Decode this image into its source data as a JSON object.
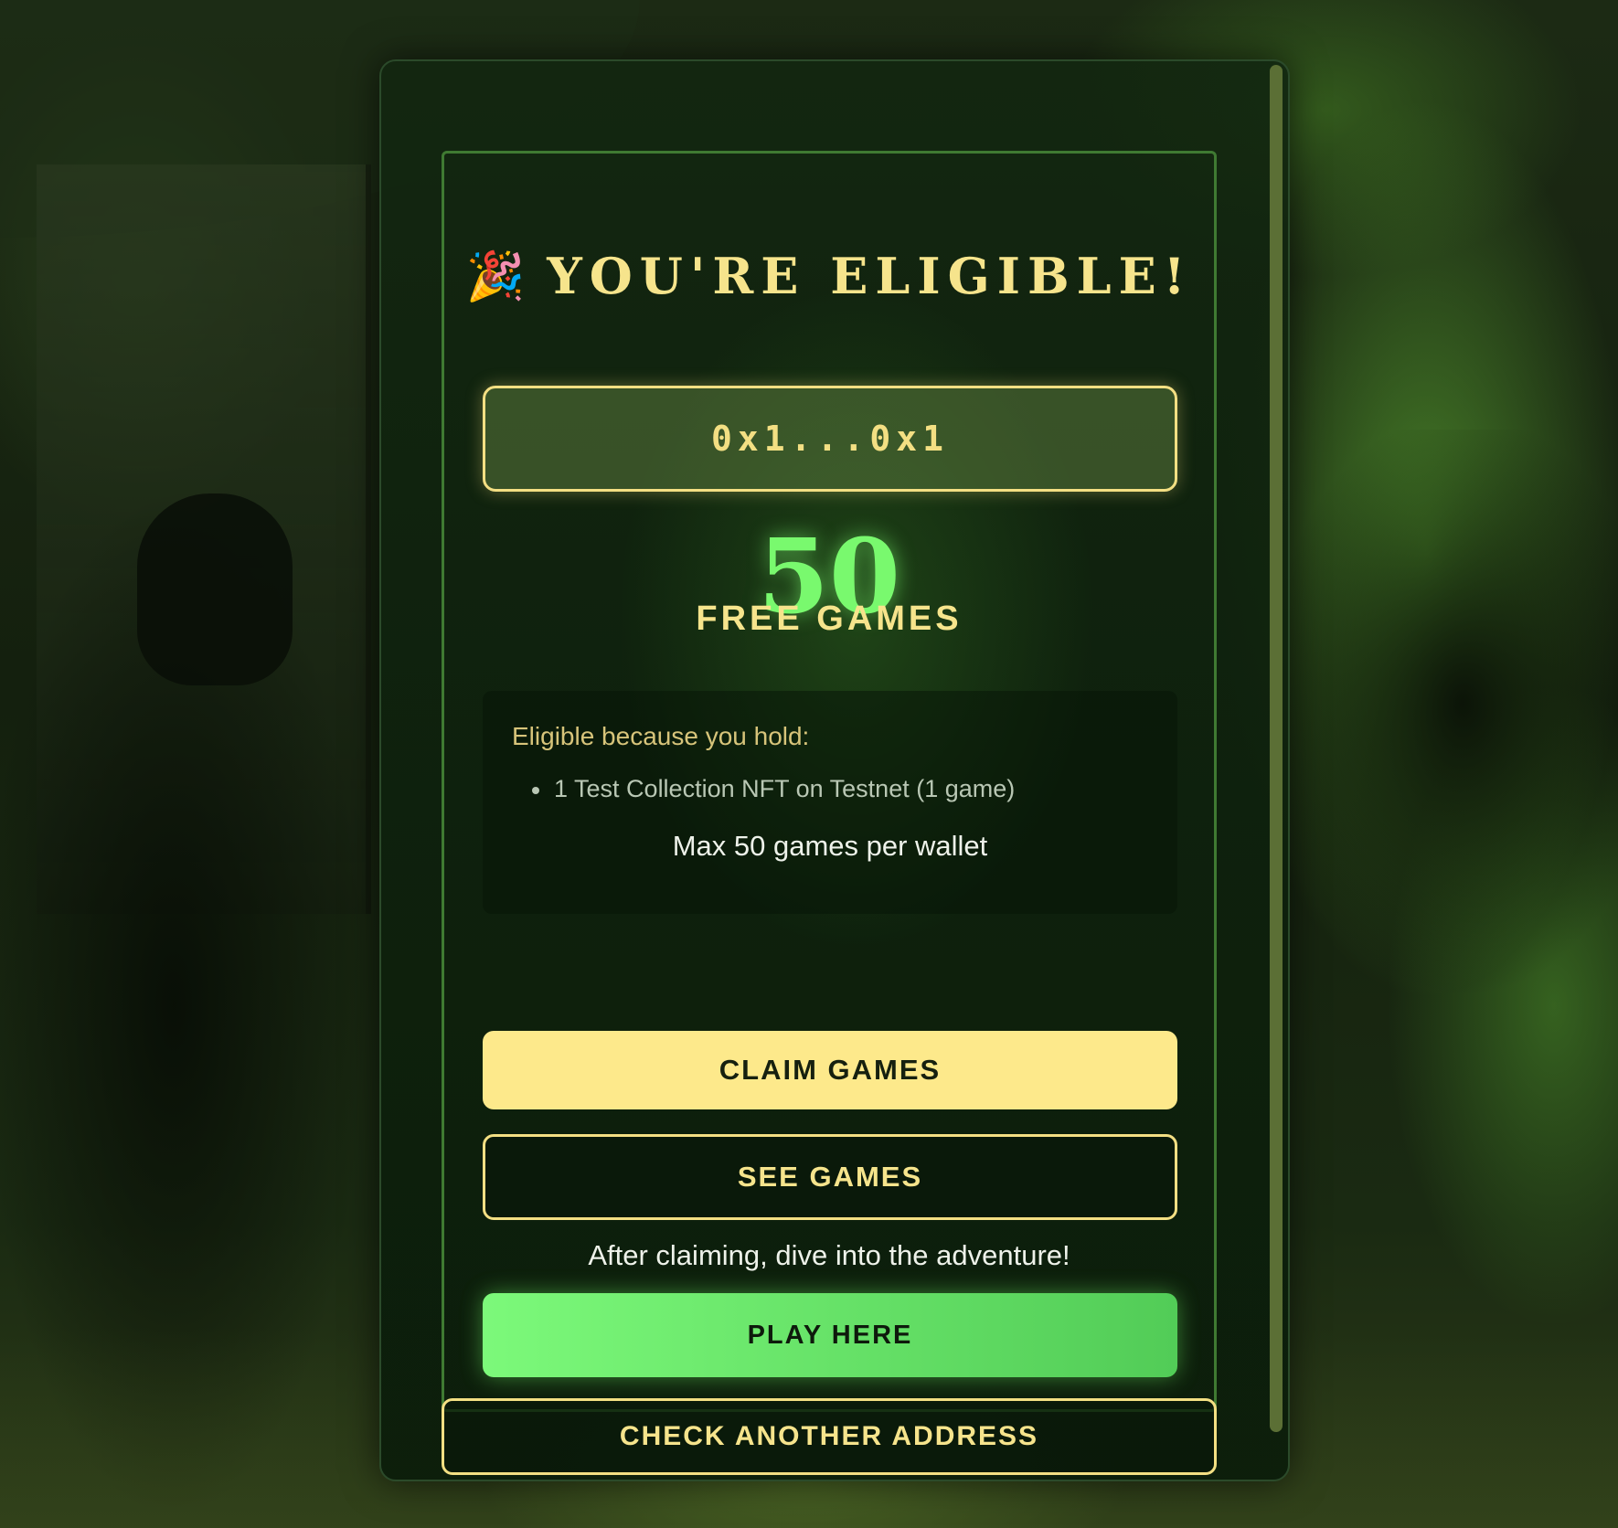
{
  "eligibility": {
    "emoji": "🎉",
    "title": "YOU'RE ELIGIBLE!",
    "address": "0x1...0x1",
    "free_games_count": "50",
    "free_games_label": "FREE GAMES",
    "reason_heading": "Eligible because you hold:",
    "holdings": [
      "1 Test Collection NFT on Testnet (1 game)"
    ],
    "max_note": "Max 50 games per wallet"
  },
  "actions": {
    "claim_label": "CLAIM GAMES",
    "see_label": "SEE GAMES",
    "after_claim_text": "After claiming, dive into the adventure!",
    "play_label": "PLAY HERE",
    "check_another_label": "CHECK ANOTHER ADDRESS"
  },
  "colors": {
    "accent_gold": "#f6e48c",
    "accent_green": "#79f96e",
    "claim_button": "#fde98b"
  }
}
